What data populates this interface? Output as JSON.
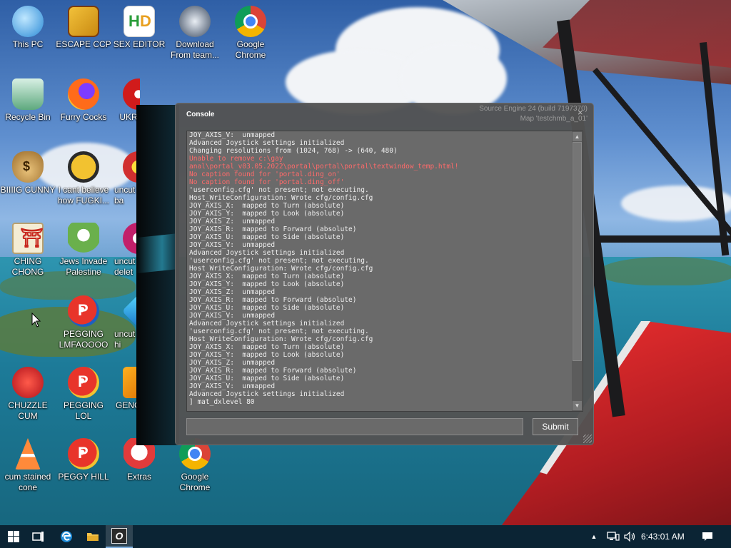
{
  "desktop": {
    "icons": [
      {
        "label": "This PC",
        "icon": "this-pc-icon"
      },
      {
        "label": "ESCAPE CCP",
        "icon": "app-icon"
      },
      {
        "label": "SEX EDITOR",
        "icon": "hex-editor-icon"
      },
      {
        "label": "Download From team...",
        "icon": "download-icon"
      },
      {
        "label": "Google Chrome",
        "icon": "chrome-icon"
      },
      {
        "label": "Recycle Bin",
        "icon": "recycle-bin-icon"
      },
      {
        "label": "Furry Cocks",
        "icon": "firefox-icon"
      },
      {
        "label": "UKR",
        "icon": "radiation-icon"
      },
      {
        "label": "BIIIIG CUNNY",
        "icon": "money-bag-icon"
      },
      {
        "label": "I cant believe how FUGKI...",
        "icon": "bird-icon"
      },
      {
        "label": "uncut ba",
        "icon": "game-icon"
      },
      {
        "label": "CHING CHONG",
        "icon": "torii-icon"
      },
      {
        "label": "Jews Invade Palestine",
        "icon": "flower-icon"
      },
      {
        "label": "uncut delet",
        "icon": "game-icon"
      },
      {
        "label": "PEGGING LMFAOOOO",
        "icon": "pegging-icon"
      },
      {
        "label": "uncut hi",
        "icon": "gem-icon"
      },
      {
        "label": "CHUZZLE CUM",
        "icon": "chuzzle-icon"
      },
      {
        "label": "PEGGING LOL",
        "icon": "pegging-icon"
      },
      {
        "label": "GENC",
        "icon": "game-icon"
      },
      {
        "label": "cum stained cone",
        "icon": "cone-icon"
      },
      {
        "label": "PEGGY HILL",
        "icon": "pegging-icon"
      },
      {
        "label": "Extras",
        "icon": "extras-icon"
      },
      {
        "label": "Google Chrome",
        "icon": "chrome-icon"
      }
    ]
  },
  "console": {
    "title": "Console",
    "engine_line1": "Source Engine 24 (build 7197370)",
    "engine_line2": "Map 'testchmb_a_01'",
    "close_symbol": "×",
    "lines": [
      {
        "text": "JOY_AXIS_V:  unmapped",
        "type": "normal"
      },
      {
        "text": "Advanced Joystick settings initialized",
        "type": "normal"
      },
      {
        "text": "Changing resolutions from (1024, 768) -> (640, 480)",
        "type": "normal"
      },
      {
        "text": "Unable to remove c:\\gay",
        "type": "error"
      },
      {
        "text": "anal\\portal_v03.05.2022\\portal\\portal\\portal\\textwindow_temp.html!",
        "type": "error"
      },
      {
        "text": "No caption found for 'portal.ding_on'",
        "type": "error"
      },
      {
        "text": "No caption found for 'portal.ding_off'",
        "type": "error"
      },
      {
        "text": "'userconfig.cfg' not present; not executing.",
        "type": "normal"
      },
      {
        "text": "Host_WriteConfiguration: Wrote cfg/config.cfg",
        "type": "normal"
      },
      {
        "text": "JOY_AXIS_X:  mapped to Turn (absolute)",
        "type": "normal"
      },
      {
        "text": "JOY_AXIS_Y:  mapped to Look (absolute)",
        "type": "normal"
      },
      {
        "text": "JOY_AXIS_Z:  unmapped",
        "type": "normal"
      },
      {
        "text": "JOY_AXIS_R:  mapped to Forward (absolute)",
        "type": "normal"
      },
      {
        "text": "JOY_AXIS_U:  mapped to Side (absolute)",
        "type": "normal"
      },
      {
        "text": "JOY_AXIS_V:  unmapped",
        "type": "normal"
      },
      {
        "text": "Advanced Joystick settings initialized",
        "type": "normal"
      },
      {
        "text": "'userconfig.cfg' not present; not executing.",
        "type": "normal"
      },
      {
        "text": "Host_WriteConfiguration: Wrote cfg/config.cfg",
        "type": "normal"
      },
      {
        "text": "JOY_AXIS_X:  mapped to Turn (absolute)",
        "type": "normal"
      },
      {
        "text": "JOY_AXIS_Y:  mapped to Look (absolute)",
        "type": "normal"
      },
      {
        "text": "JOY_AXIS_Z:  unmapped",
        "type": "normal"
      },
      {
        "text": "JOY_AXIS_R:  mapped to Forward (absolute)",
        "type": "normal"
      },
      {
        "text": "JOY_AXIS_U:  mapped to Side (absolute)",
        "type": "normal"
      },
      {
        "text": "JOY_AXIS_V:  unmapped",
        "type": "normal"
      },
      {
        "text": "Advanced Joystick settings initialized",
        "type": "normal"
      },
      {
        "text": "'userconfig.cfg' not present; not executing.",
        "type": "normal"
      },
      {
        "text": "Host_WriteConfiguration: Wrote cfg/config.cfg",
        "type": "normal"
      },
      {
        "text": "JOY_AXIS_X:  mapped to Turn (absolute)",
        "type": "normal"
      },
      {
        "text": "JOY_AXIS_Y:  mapped to Look (absolute)",
        "type": "normal"
      },
      {
        "text": "JOY_AXIS_Z:  unmapped",
        "type": "normal"
      },
      {
        "text": "JOY_AXIS_R:  mapped to Forward (absolute)",
        "type": "normal"
      },
      {
        "text": "JOY_AXIS_U:  mapped to Side (absolute)",
        "type": "normal"
      },
      {
        "text": "JOY_AXIS_V:  unmapped",
        "type": "normal"
      },
      {
        "text": "Advanced Joystick settings initialized",
        "type": "normal"
      },
      {
        "text": "] mat_dxlevel 80",
        "type": "normal"
      }
    ],
    "input_value": "",
    "submit_label": "Submit",
    "scroll_up_symbol": "▲",
    "scroll_down_symbol": "▼"
  },
  "taskbar": {
    "items": [
      {
        "icon": "windows-start-icon"
      },
      {
        "icon": "task-view-icon"
      },
      {
        "icon": "edge-icon"
      },
      {
        "icon": "file-explorer-icon"
      },
      {
        "icon": "console-app-icon",
        "active": true
      }
    ],
    "tray_up_symbol": "▲",
    "time": "6:43:01 AM"
  },
  "colors": {
    "error_text": "#ff6a6a",
    "console_bg": "#525252",
    "taskbar_bg": "#0a1e2d"
  }
}
